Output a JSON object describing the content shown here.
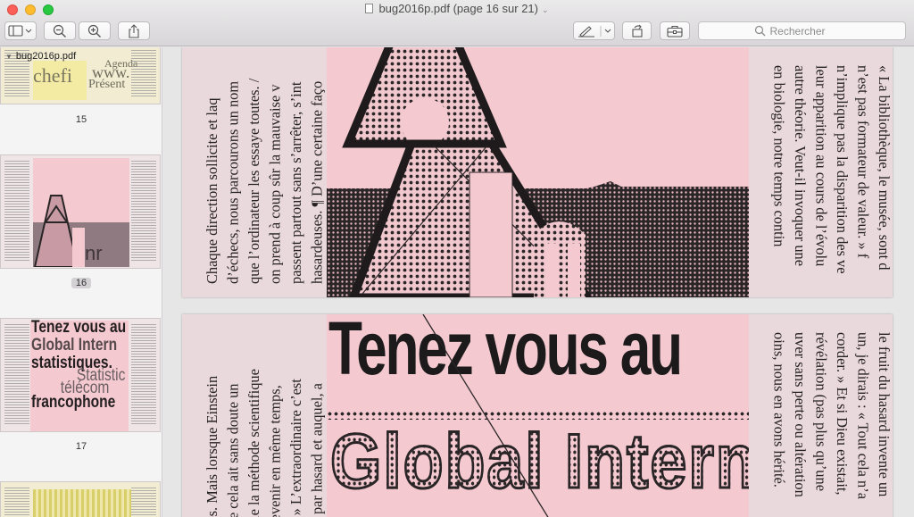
{
  "window": {
    "title": "bug2016p.pdf (page 16 sur 21)"
  },
  "toolbar": {
    "sidebar_toggle_icon": "sidebar-icon",
    "zoom_out_icon": "zoom-out-icon",
    "zoom_in_icon": "zoom-in-icon",
    "share_icon": "share-icon",
    "markup_icon": "pen-icon",
    "rotate_icon": "rotate-icon",
    "toolbox_icon": "toolbox-icon",
    "search_placeholder": "Rechercher"
  },
  "sidebar": {
    "filename": "bug2016p.pdf",
    "pages": [
      {
        "label": "15",
        "thumb_text": [
          "Agenda",
          "chefi",
          "www.",
          "Présent"
        ]
      },
      {
        "label": "16",
        "selected": true
      },
      {
        "label": "17",
        "thumb_text": [
          "Tenez vous au",
          "Global Intern",
          "statistiques.",
          "Statistic",
          "télécom",
          "francophone"
        ]
      }
    ]
  },
  "document": {
    "page16": {
      "left_column": [
        "Chaque direction sollicite et laq",
        "d’échecs, nous parcourons un nom",
        "que l’ordinateur les essaye toutes. /",
        "on prend à coup sûr la mauvaise v",
        "passent partout sans s’arrêter, s’int",
        "hasardeuses. ¶ D’une certaine faço"
      ],
      "right_column": [
        "« La bibliothèque, le musée, sont d",
        "n’est pas formateur de valeur. » f",
        "n’implique pas la disparition des ve",
        "leur apparition au cours de l’évolu",
        "autre théorie. Veut-il invoquer une",
        "en biologie, notre temps contin"
      ]
    },
    "page17": {
      "left_column": [
        "odes. Mais lorsque Einstein",
        "telle cela ait sans doute un",
        "uelle la méthode scientifique",
        "s devenir en même temps,",
        "nu. » L’extraordinaire c’est",
        "fait par hasard et auquel, a"
      ],
      "right_column": [
        "le fruit du hasard invente un",
        "un, je dirais : « Tout cela n’a",
        "corder. » Et si Dieu existait,",
        "révélation (pas plus qu’une",
        "uver sans perte ou altération",
        "oins, nous en avons hérité."
      ],
      "headline_1": "Tenez vous au",
      "headline_2": "Global Intern"
    }
  },
  "colors": {
    "page_pink": "#ead9dc",
    "graphic_pink": "#f4c9d0",
    "ink": "#262223"
  }
}
